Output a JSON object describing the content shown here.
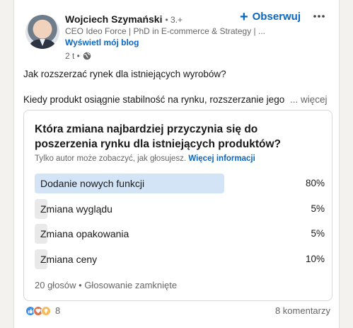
{
  "post": {
    "author": {
      "name": "Wojciech Szymański",
      "degree": "• 3.+",
      "headline": "CEO Ideo Force | PhD in E-commerce & Strategy | ...",
      "blog_link": "Wyświetl mój blog",
      "time": "2 t •"
    },
    "follow_label": "Obserwuj",
    "text_line1": "Jak rozszerzać rynek dla istniejących wyrobów?",
    "text_line2": "Kiedy produkt osiągnie stabilność na rynku, rozszerzanie jego",
    "see_more": "... więcej"
  },
  "poll": {
    "question": "Która zmiana najbardziej przyczynia się do poszerzenia rynku dla istniejących produktów?",
    "visibility_note": "Tylko autor może zobaczyć, jak głosujesz.",
    "more_info_link": "Więcej informacji",
    "options": [
      {
        "label": "Dodanie nowych funkcji",
        "percent_label": "80%",
        "share": 0.8,
        "winner": true
      },
      {
        "label": "Zmiana wyglądu",
        "percent_label": "5%",
        "share": 0.05,
        "winner": false
      },
      {
        "label": "Zmiana opakowania",
        "percent_label": "5%",
        "share": 0.05,
        "winner": false
      },
      {
        "label": "Zmiana ceny",
        "percent_label": "10%",
        "share": 0.1,
        "winner": false
      }
    ],
    "footer": "20 głosów • Głosowanie zamknięte"
  },
  "social": {
    "reaction_icons": [
      "like-icon",
      "love-icon",
      "insightful-icon"
    ],
    "reaction_count": "8",
    "comments": "8 komentarzy"
  },
  "colors": {
    "accent": "#0a66c2",
    "winner_bar": "#d4e4f7",
    "other_bar": "#e9e9e9"
  }
}
